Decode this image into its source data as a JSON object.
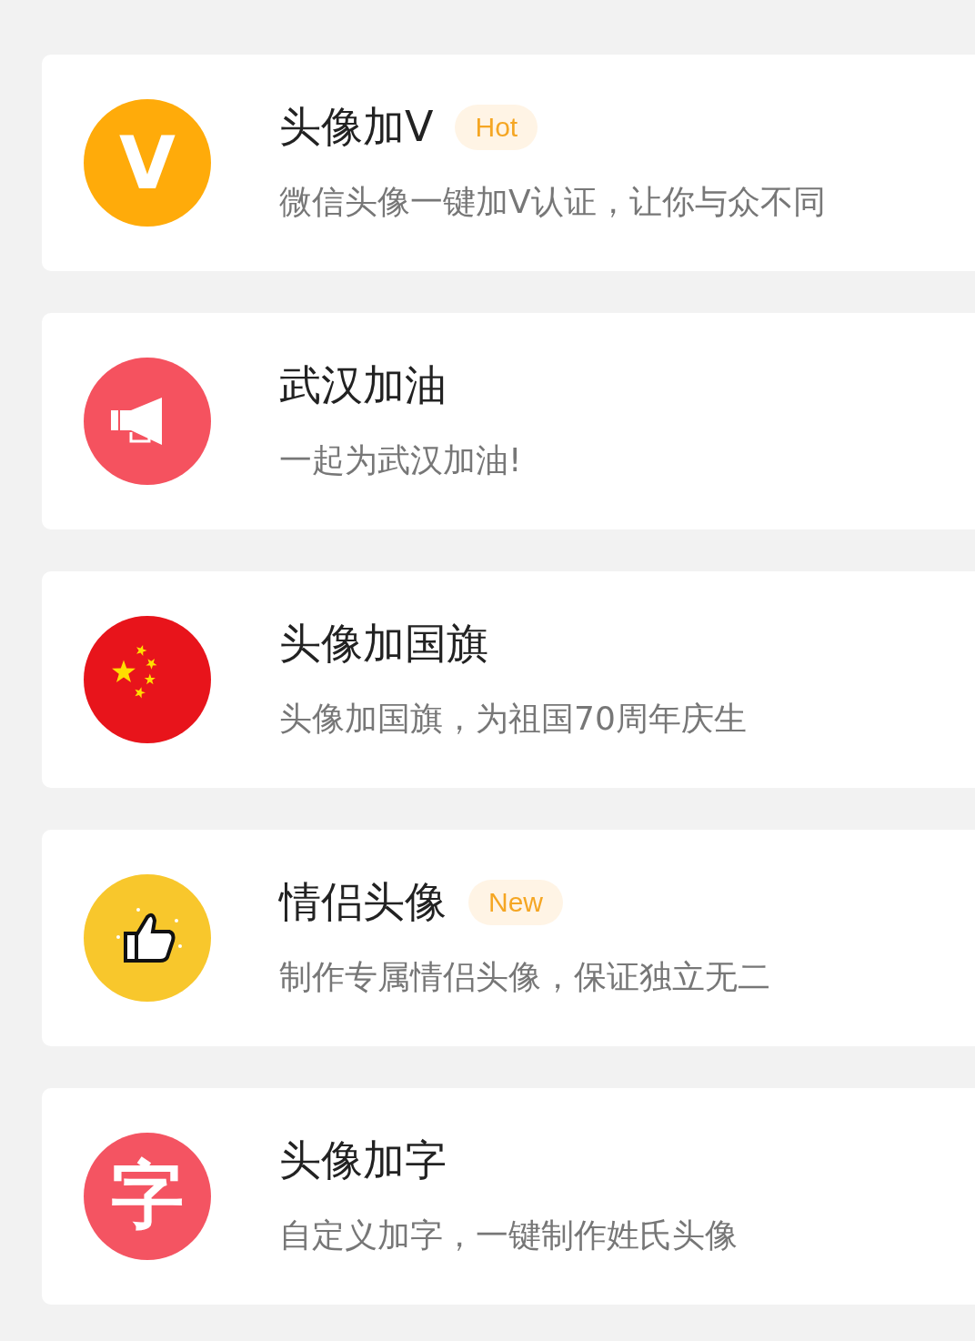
{
  "items": [
    {
      "kind": "letter",
      "icon_text": "V",
      "color": "#ffab0a",
      "title": "头像加V",
      "badge": "Hot",
      "subtitle": "微信头像一键加V认证，让你与众不同"
    },
    {
      "kind": "megaphone",
      "color": "#f5525f",
      "title": "武汉加油",
      "subtitle": "一起为武汉加油!"
    },
    {
      "kind": "flag",
      "color": "#e8141b",
      "title": "头像加国旗",
      "subtitle": "头像加国旗，为祖国70周年庆生"
    },
    {
      "kind": "thumb",
      "color": "#f8c72c",
      "title": "情侣头像",
      "badge": "New",
      "subtitle": "制作专属情侣头像，保证独立无二"
    },
    {
      "kind": "letter",
      "icon_text": "字",
      "color": "#f45462",
      "title": "头像加字",
      "subtitle": "自定义加字，一键制作姓氏头像"
    }
  ]
}
